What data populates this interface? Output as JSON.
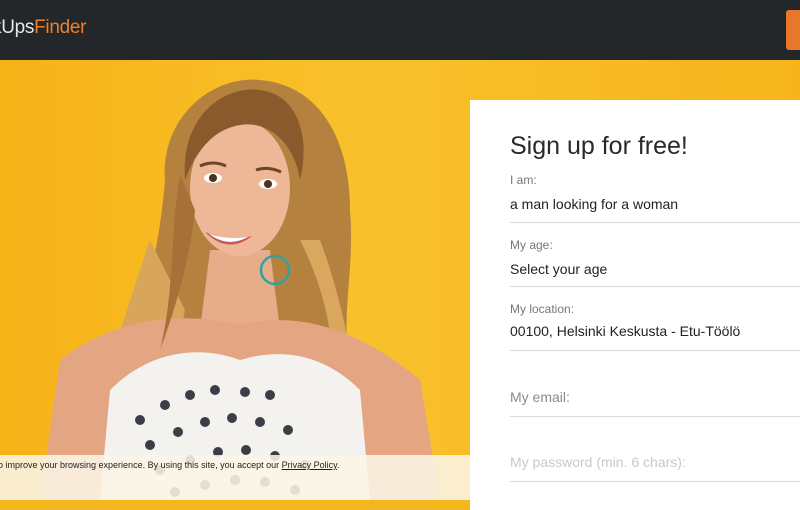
{
  "header": {
    "logo_part1": "kUps",
    "logo_part2": "Finder"
  },
  "form": {
    "title": "Sign up for free!",
    "i_am_label": "I am:",
    "i_am_value": "a man looking for a woman",
    "age_label": "My age:",
    "age_value": "Select your age",
    "location_label": "My location:",
    "location_value": "00100, Helsinki Keskusta - Etu-Töölö",
    "email_placeholder": "My email:",
    "password_placeholder": "My password (min. 6 chars):"
  },
  "cookie": {
    "text": "o improve your browsing experience. By using this site, you accept our ",
    "link": "Privacy Policy",
    "suffix": "."
  },
  "colors": {
    "topbar": "#23272a",
    "accent": "#f07f2a",
    "hero_yellow": "#f7b318"
  }
}
